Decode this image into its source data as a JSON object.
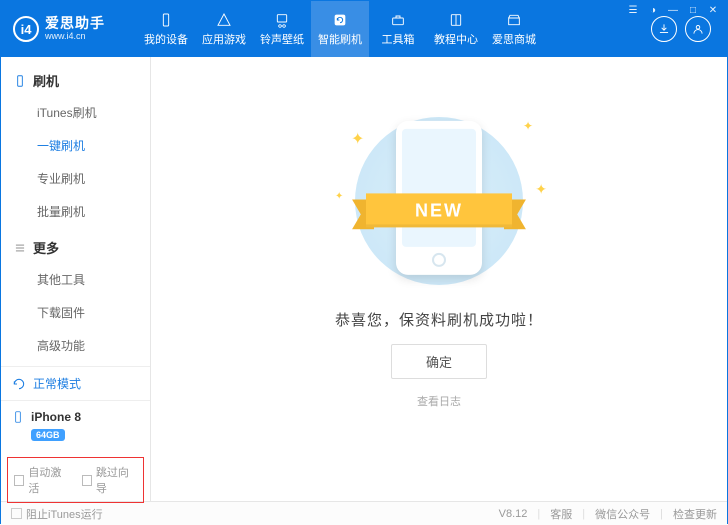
{
  "app": {
    "logo_initials": "i4",
    "title": "爱思助手",
    "subtitle": "www.i4.cn"
  },
  "nav": [
    {
      "label": "我的设备",
      "icon": "device"
    },
    {
      "label": "应用游戏",
      "icon": "apps"
    },
    {
      "label": "铃声壁纸",
      "icon": "music"
    },
    {
      "label": "智能刷机",
      "icon": "flash",
      "active": true
    },
    {
      "label": "工具箱",
      "icon": "toolbox"
    },
    {
      "label": "教程中心",
      "icon": "book"
    },
    {
      "label": "爱思商城",
      "icon": "store"
    }
  ],
  "sidebar": {
    "groups": [
      {
        "title": "刷机",
        "kind": "flash",
        "items": [
          {
            "label": "iTunes刷机"
          },
          {
            "label": "一键刷机",
            "active": true
          },
          {
            "label": "专业刷机"
          },
          {
            "label": "批量刷机"
          }
        ]
      },
      {
        "title": "更多",
        "kind": "more",
        "items": [
          {
            "label": "其他工具"
          },
          {
            "label": "下载固件"
          },
          {
            "label": "高级功能"
          }
        ]
      }
    ],
    "status": "正常模式",
    "device": {
      "name": "iPhone 8",
      "storage": "64GB"
    },
    "checks": [
      {
        "label": "自动激活"
      },
      {
        "label": "跳过向导"
      }
    ]
  },
  "main": {
    "ribbon": "NEW",
    "message": "恭喜您，保资料刷机成功啦！",
    "ok": "确定",
    "loglink": "查看日志"
  },
  "footer": {
    "left_check": "阻止iTunes运行",
    "version": "V8.12",
    "links": [
      "客服",
      "微信公众号",
      "检查更新"
    ]
  }
}
